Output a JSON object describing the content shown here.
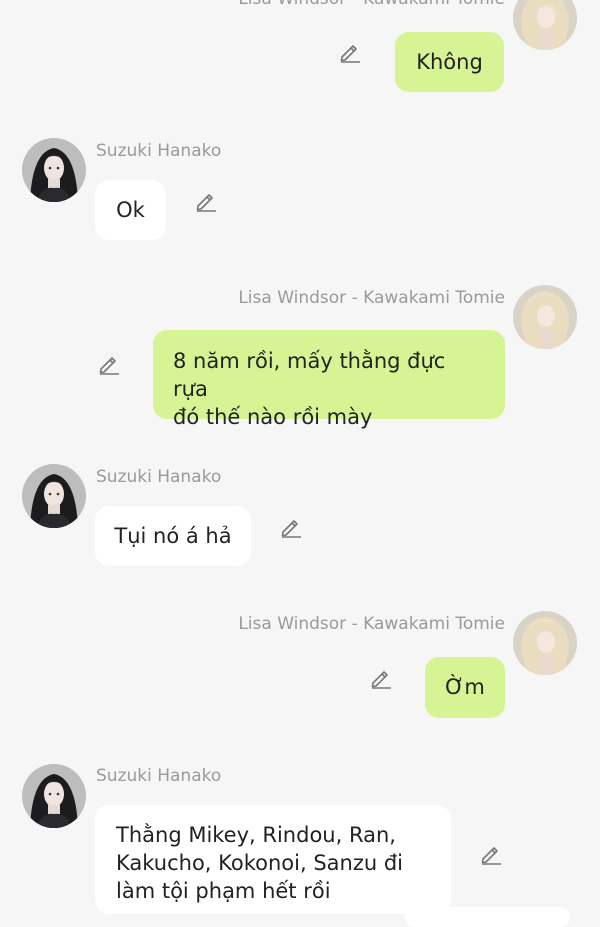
{
  "colors": {
    "background": "#f6f6f6",
    "outgoing_bubble": "#d6f493",
    "incoming_bubble": "#ffffff",
    "name_text": "#9a9a9a",
    "message_text": "#222222"
  },
  "messages": [
    {
      "sender": "Lisa Windsor - Kawakami Tomie",
      "direction": "outgoing",
      "text": "Không",
      "avatar_icon": "blonde-avatar",
      "action_icon": "edit-icon"
    },
    {
      "sender": "Suzuki Hanako",
      "direction": "incoming",
      "text": "Ok",
      "avatar_icon": "dark-hair-avatar",
      "action_icon": "edit-icon"
    },
    {
      "sender": "Lisa Windsor - Kawakami Tomie",
      "direction": "outgoing",
      "lines": [
        "8 năm rồi, mấy thằng đực rựa",
        "đó thế nào rồi mày"
      ],
      "avatar_icon": "blonde-avatar",
      "action_icon": "edit-icon"
    },
    {
      "sender": "Suzuki Hanako",
      "direction": "incoming",
      "text": "Tụi nó á hả",
      "avatar_icon": "dark-hair-avatar",
      "action_icon": "edit-icon"
    },
    {
      "sender": "Lisa Windsor - Kawakami Tomie",
      "direction": "outgoing",
      "text": "Ờm",
      "avatar_icon": "blonde-avatar",
      "action_icon": "edit-icon"
    },
    {
      "sender": "Suzuki Hanako",
      "direction": "incoming",
      "lines": [
        "Thằng Mikey, Rindou, Ran,",
        "Kakucho, Kokonoi, Sanzu đi",
        "làm tội phạm hết rồi"
      ],
      "avatar_icon": "dark-hair-avatar",
      "action_icon": "edit-icon"
    }
  ]
}
